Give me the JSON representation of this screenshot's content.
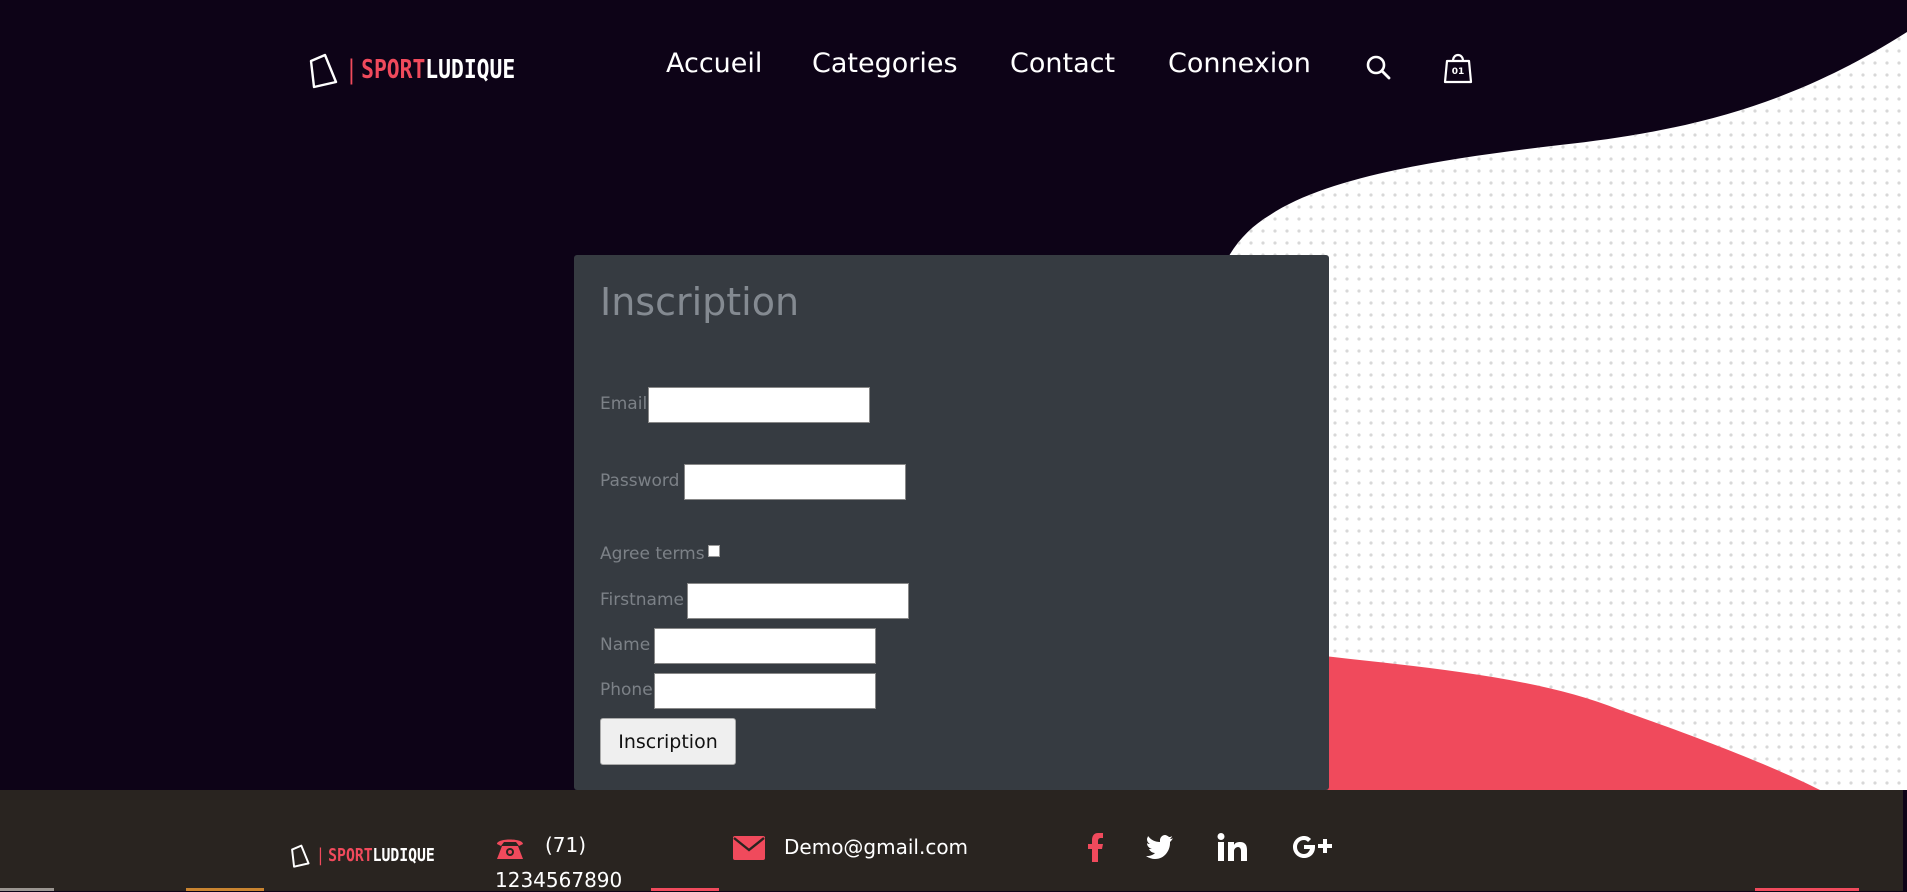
{
  "brand": {
    "logo_bar": "|",
    "logo_part1": "SPORT",
    "logo_part2": "LUDIQUE"
  },
  "nav": {
    "items": [
      {
        "label": "Accueil"
      },
      {
        "label": "Categories"
      },
      {
        "label": "Contact"
      },
      {
        "label": "Connexion"
      }
    ],
    "cart_count": "01"
  },
  "form": {
    "title": "Inscription",
    "email_label": "Email",
    "email_value": "",
    "password_label": "Password",
    "password_value": "",
    "agree_label": "Agree terms",
    "agree_checked": false,
    "firstname_label": "Firstname",
    "firstname_value": "",
    "name_label": "Name",
    "name_value": "",
    "phone_label": "Phone",
    "phone_value": "",
    "submit_label": "Inscription"
  },
  "footer": {
    "phone_line1": "(71)",
    "phone_line2": "1234567890",
    "email": "Demo@gmail.com",
    "social": [
      "facebook-icon",
      "twitter-icon",
      "linkedin-icon",
      "google-plus-icon"
    ]
  },
  "colors": {
    "background": "#0d0317",
    "accent": "#f04a5c",
    "card": "#363b41",
    "footer": "#292420"
  }
}
